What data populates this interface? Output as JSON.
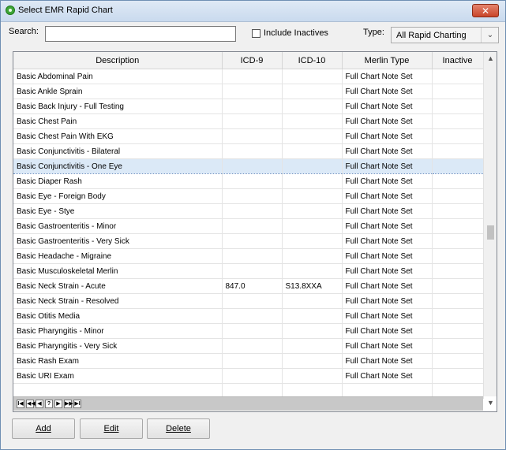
{
  "window": {
    "title": "Select EMR  Rapid Chart",
    "close_label": "✕"
  },
  "toolbar": {
    "search_label": "Search:",
    "search_value": "",
    "include_inactives_label": "Include Inactives",
    "include_inactives_checked": false,
    "type_label": "Type:",
    "type_value": "All  Rapid Charting"
  },
  "grid": {
    "columns": [
      "Description",
      "ICD-9",
      "ICD-10",
      "Merlin Type",
      "Inactive"
    ],
    "rows": [
      [
        "Basic Abdominal Pain",
        "",
        "",
        "Full Chart Note Set",
        ""
      ],
      [
        "Basic Ankle Sprain",
        "",
        "",
        "Full Chart Note Set",
        ""
      ],
      [
        "Basic Back Injury - Full Testing",
        "",
        "",
        "Full Chart Note Set",
        ""
      ],
      [
        "Basic Chest Pain",
        "",
        "",
        "Full Chart Note Set",
        ""
      ],
      [
        "Basic Chest Pain With EKG",
        "",
        "",
        "Full Chart Note Set",
        ""
      ],
      [
        "Basic Conjunctivitis - Bilateral",
        "",
        "",
        "Full Chart Note Set",
        ""
      ],
      [
        "Basic Conjunctivitis - One Eye",
        "",
        "",
        "Full Chart Note Set",
        ""
      ],
      [
        "Basic Diaper Rash",
        "",
        "",
        "Full Chart Note Set",
        ""
      ],
      [
        "Basic Eye - Foreign Body",
        "",
        "",
        "Full Chart Note Set",
        ""
      ],
      [
        "Basic Eye - Stye",
        "",
        "",
        "Full Chart Note Set",
        ""
      ],
      [
        "Basic Gastroenteritis - Minor",
        "",
        "",
        "Full Chart Note Set",
        ""
      ],
      [
        "Basic Gastroenteritis - Very Sick",
        "",
        "",
        "Full Chart Note Set",
        ""
      ],
      [
        "Basic Headache - Migraine",
        "",
        "",
        "Full Chart Note Set",
        ""
      ],
      [
        "Basic Musculoskeletal Merlin",
        "",
        "",
        "Full Chart Note Set",
        ""
      ],
      [
        "Basic Neck Strain - Acute",
        "847.0",
        "S13.8XXA",
        "Full Chart Note Set",
        ""
      ],
      [
        "Basic Neck Strain - Resolved",
        "",
        "",
        "Full Chart Note Set",
        ""
      ],
      [
        "Basic Otitis Media",
        "",
        "",
        "Full Chart Note Set",
        ""
      ],
      [
        "Basic Pharyngitis - Minor",
        "",
        "",
        "Full Chart Note Set",
        ""
      ],
      [
        "Basic Pharyngitis - Very Sick",
        "",
        "",
        "Full Chart Note Set",
        ""
      ],
      [
        "Basic Rash Exam",
        "",
        "",
        "Full Chart Note Set",
        ""
      ],
      [
        "Basic URI Exam",
        "",
        "",
        "Full Chart Note Set",
        ""
      ],
      [
        "",
        "",
        "",
        "",
        ""
      ]
    ],
    "selected_row": 6,
    "nav_buttons": [
      "I◀",
      "◀◀",
      "◀",
      "?",
      "▶",
      "▶▶",
      "▶I"
    ]
  },
  "buttons": {
    "add": "Add",
    "edit": "Edit",
    "delete": "Delete"
  },
  "colors": {
    "selected_row": "#dbe9f7",
    "titlebar": "#c9daee",
    "close": "#c9452a"
  }
}
